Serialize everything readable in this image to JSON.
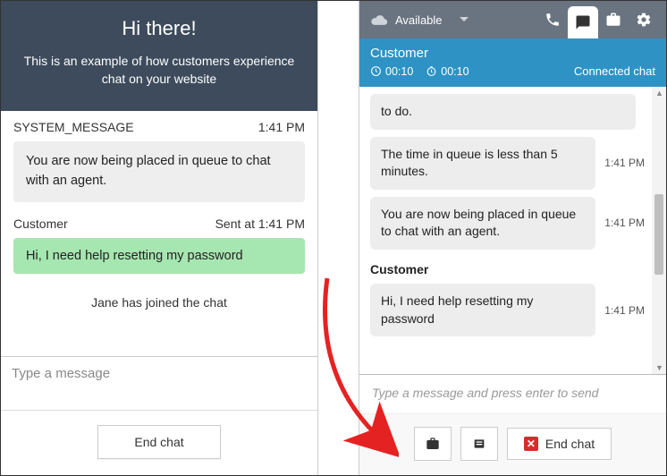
{
  "left": {
    "banner_title": "Hi there!",
    "banner_sub": "This is an example of how customers experience chat on your website",
    "messages": [
      {
        "sender": "SYSTEM_MESSAGE",
        "time": "1:41 PM",
        "text": "You are now being placed in queue to chat with an agent.",
        "style": "grey"
      },
      {
        "sender": "Customer",
        "time": "Sent at  1:41 PM",
        "text": "Hi, I need help resetting my password",
        "style": "green"
      }
    ],
    "joined_text": "Jane has joined the chat",
    "input_placeholder": "Type a message",
    "end_chat_label": "End chat"
  },
  "right": {
    "availability": "Available",
    "customer_label": "Customer",
    "timer1": "00:10",
    "timer2": "00:10",
    "connection_status": "Connected chat",
    "messages": [
      {
        "text": "to do.",
        "time": ""
      },
      {
        "text": "The time in queue is less than 5 minutes.",
        "time": "1:41 PM"
      },
      {
        "text": "You are now being placed in queue to chat with an agent.",
        "time": "1:41 PM"
      }
    ],
    "customer_sender": "Customer",
    "customer_msg": {
      "text": "Hi, I need help resetting my password",
      "time": "1:41 PM"
    },
    "input_placeholder": "Type a message and press enter to send",
    "end_chat_label": "End chat"
  }
}
